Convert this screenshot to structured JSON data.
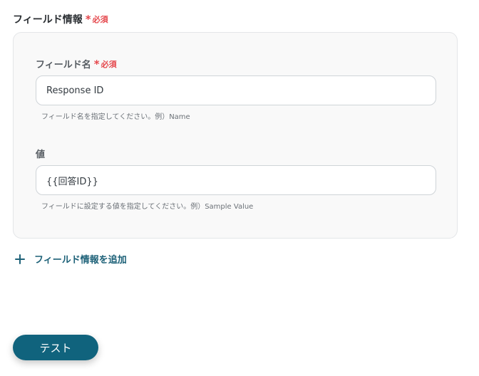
{
  "section": {
    "title": "フィールド情報",
    "required_mark": "*",
    "required_text": "必須"
  },
  "fields": [
    {
      "label": "フィールド名",
      "required_mark": "*",
      "required_text": "必須",
      "value": "Response ID",
      "hint": "フィールド名を指定してください。例）Name"
    },
    {
      "label": "値",
      "value": "{{回答ID}}",
      "hint": "フィールドに設定する値を指定してください。例）Sample Value"
    }
  ],
  "add_field": {
    "label": "フィールド情報を追加",
    "icon": "plus-icon"
  },
  "test_button": {
    "label": "テスト"
  },
  "colors": {
    "accent": "#10637d",
    "link": "#1d6178",
    "required": "#e5484d"
  }
}
